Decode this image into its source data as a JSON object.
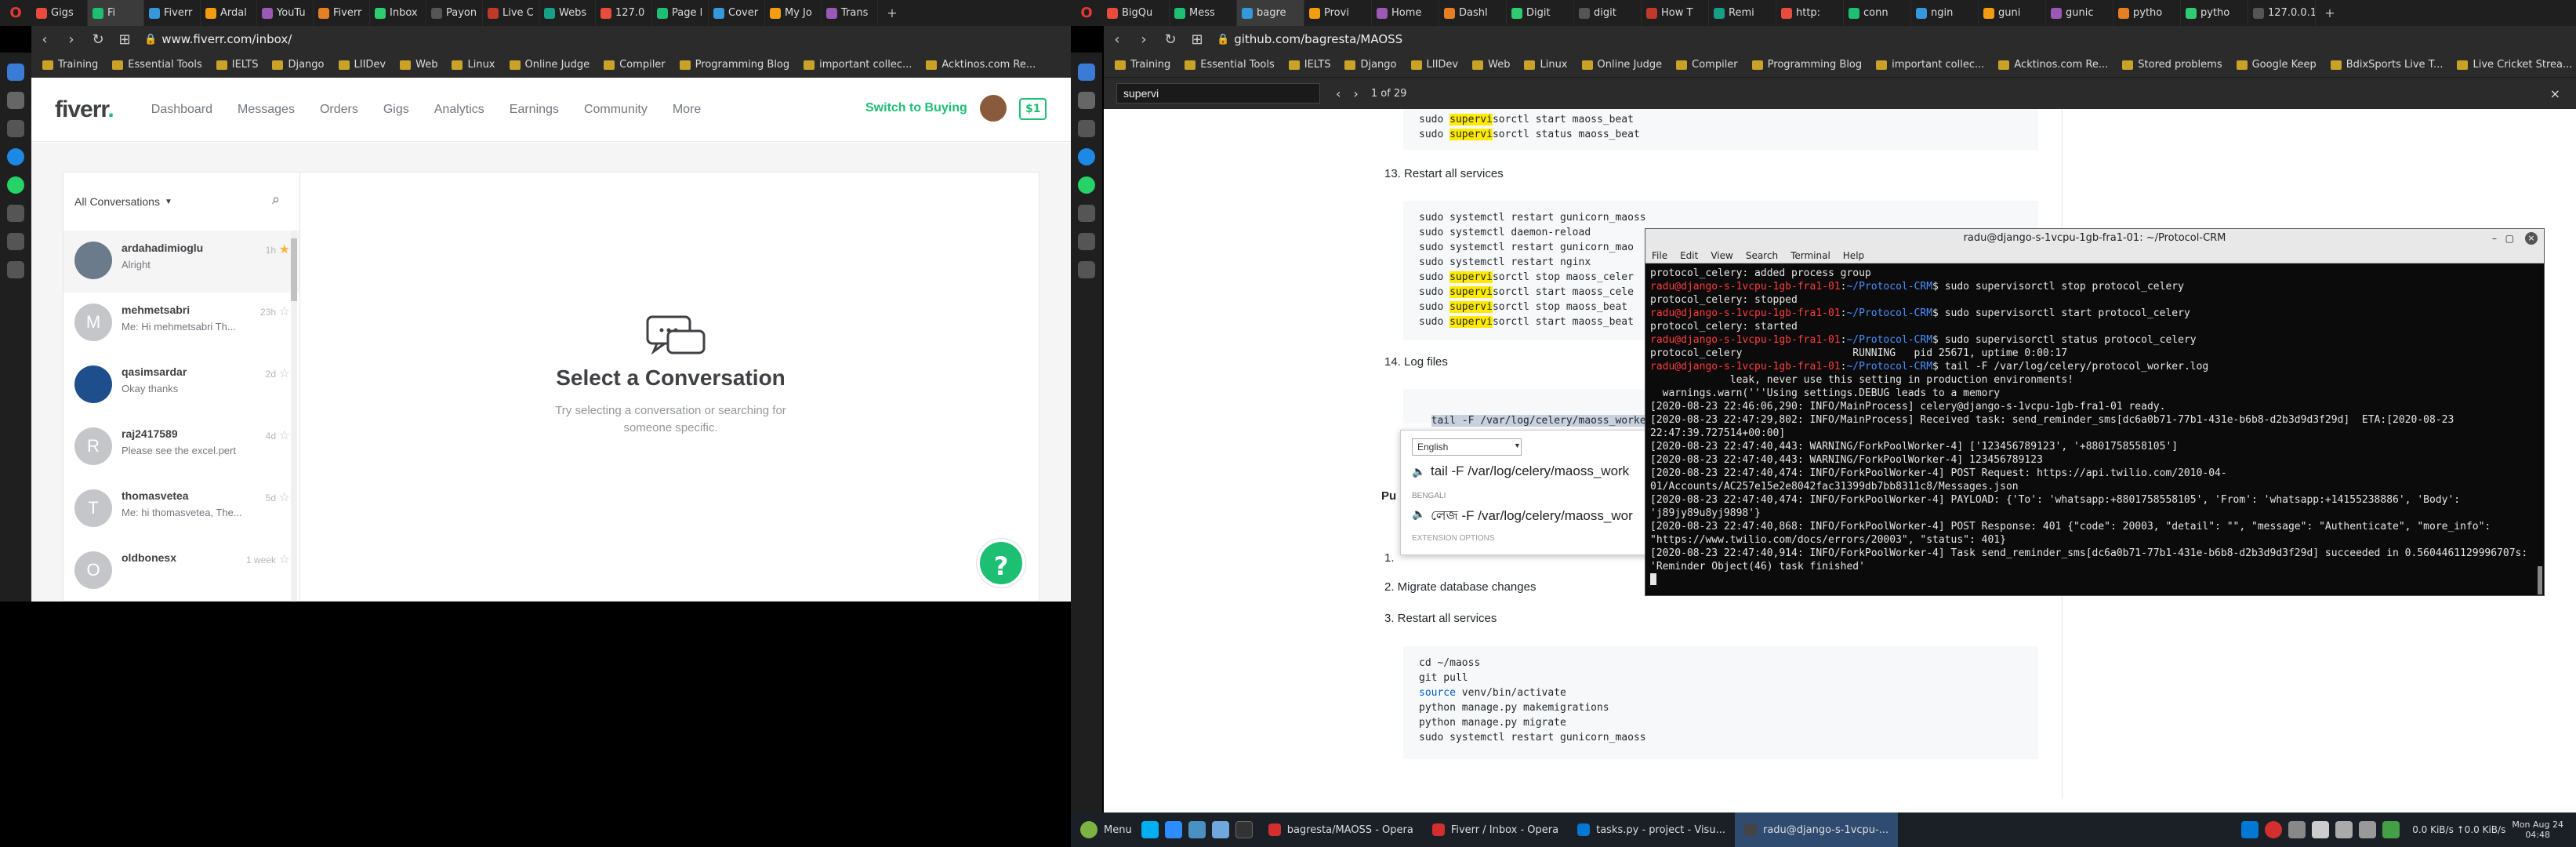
{
  "left_browser": {
    "tabs": [
      "Gigs",
      "Fi",
      "Fiverr",
      "Ardal",
      "YouTu",
      "Fiverr",
      "Inbox",
      "Payon",
      "Live C",
      "Webs",
      "127.0",
      "Page l",
      "Cover",
      "My Jo",
      "Trans"
    ],
    "url": "www.fiverr.com/inbox/",
    "bookmarks": [
      "Training",
      "Essential Tools",
      "IELTS",
      "Django",
      "LIIDev",
      "Web",
      "Linux",
      "Online Judge",
      "Compiler",
      "Programming Blog",
      "important collec...",
      "Acktinos.com Re..."
    ]
  },
  "fiverr": {
    "logo": "fiverr",
    "nav": [
      "Dashboard",
      "Messages",
      "Orders",
      "Gigs",
      "Analytics",
      "Earnings",
      "Community",
      "More"
    ],
    "switch_label": "Switch to Buying",
    "balance": "$1",
    "filter_label": "All Conversations",
    "conversations": [
      {
        "name": "ardahadimioglu",
        "msg": "Alright",
        "time": "1h",
        "initial": "",
        "color": "#6b7b8c",
        "starred": true
      },
      {
        "name": "mehmetsabri",
        "msg": "Me: Hi mehmetsabri Th...",
        "time": "23h",
        "initial": "M",
        "color": "#c5c6c9",
        "starred": false
      },
      {
        "name": "qasimsardar",
        "msg": "Okay thanks",
        "time": "2d",
        "initial": "",
        "color": "#1f4e8c",
        "starred": false
      },
      {
        "name": "raj2417589",
        "msg": "Please see the excel.pert",
        "time": "4d",
        "initial": "R",
        "color": "#c5c6c9",
        "starred": false
      },
      {
        "name": "thomasvetea",
        "msg": "Me: hi thomasvetea, The...",
        "time": "5d",
        "initial": "T",
        "color": "#c5c6c9",
        "starred": false
      },
      {
        "name": "oldbonesx",
        "msg": "",
        "time": "1 week",
        "initial": "O",
        "color": "#c5c6c9",
        "starred": false
      }
    ],
    "empty_title": "Select a Conversation",
    "empty_sub": "Try selecting a conversation or searching for someone specific.",
    "help": "?"
  },
  "right_browser": {
    "tabs": [
      "BigQu",
      "Mess",
      "bagre",
      "Provi",
      "Home",
      "Dashl",
      "Digit",
      "digit",
      "How T",
      "Remi",
      "http:",
      "conn",
      "ngin",
      "guni",
      "gunic",
      "pytho",
      "pytho",
      "127.0.0.1"
    ],
    "url": "github.com/bagresta/MAOSS",
    "bookmarks": [
      "Training",
      "Essential Tools",
      "IELTS",
      "Django",
      "LIIDev",
      "Web",
      "Linux",
      "Online Judge",
      "Compiler",
      "Programming Blog",
      "important collec...",
      "Acktinos.com Re...",
      "Stored problems",
      "Google Keep",
      "BdixSports Live T...",
      "Live Cricket Strea..."
    ],
    "find_query": "supervi",
    "find_count": "1 of 29"
  },
  "github": {
    "code_top": [
      "sudo supervisorctl start maoss_beat",
      "sudo supervisorctl status maoss_beat"
    ],
    "step13": "13. Restart all services",
    "code13": [
      "sudo systemctl restart gunicorn_maoss",
      "sudo systemctl daemon-reload",
      "sudo systemctl restart gunicorn_mao",
      "sudo systemctl restart nginx",
      "sudo supervisorctl stop maoss_celer",
      "sudo supervisorctl start maoss_cele",
      "sudo supervisorctl stop maoss_beat",
      "sudo supervisorctl start maoss_beat"
    ],
    "step14": "14. Log files",
    "log_line": "tail -F /var/log/celery/maoss_worke",
    "pu_prefix": "Pu",
    "step1": "1.",
    "step2": "2. Migrate database changes",
    "step3": "3. Restart all services",
    "code_bottom": [
      "cd ~/maoss",
      "git pull",
      "source venv/bin/activate",
      "python manage.py makemigrations",
      "python manage.py migrate",
      "sudo systemctl restart gunicorn_maoss"
    ]
  },
  "translate_popup": {
    "language": "English",
    "line1": "tail -F /var/log/celery/maoss_work",
    "section": "BENGALI",
    "line2": "লেজ -F /var/log/celery/maoss_wor",
    "options": "EXTENSION OPTIONS"
  },
  "terminal": {
    "title": "radu@django-s-1vcpu-1gb-fra1-01: ~/Protocol-CRM",
    "menu": [
      "File",
      "Edit",
      "View",
      "Search",
      "Terminal",
      "Help"
    ],
    "lines": [
      "protocol_celery: added process group",
      "radu@django-s-1vcpu-1gb-fra1-01:~/Protocol-CRM$ sudo supervisorctl stop protocol_celery",
      "protocol_celery: stopped",
      "radu@django-s-1vcpu-1gb-fra1-01:~/Protocol-CRM$ sudo supervisorctl start protocol_celery",
      "protocol_celery: started",
      "radu@django-s-1vcpu-1gb-fra1-01:~/Protocol-CRM$ sudo supervisorctl status protocol_celery",
      "protocol_celery                  RUNNING   pid 25671, uptime 0:00:17",
      "radu@django-s-1vcpu-1gb-fra1-01:~/Protocol-CRM$ tail -F /var/log/celery/protocol_worker.log",
      "             leak, never use this setting in production environments!",
      "  warnings.warn('''Using settings.DEBUG leads to a memory",
      "[2020-08-23 22:46:06,290: INFO/MainProcess] celery@django-s-1vcpu-1gb-fra1-01 ready.",
      "[2020-08-23 22:47:29,802: INFO/MainProcess] Received task: send_reminder_sms[dc6a0b71-77b1-431e-b6b8-d2b3d9d3f29d]  ETA:[2020-08-23 22:47:39.727514+00:00]",
      "[2020-08-23 22:47:40,443: WARNING/ForkPoolWorker-4] ['123456789123', '+8801758558105']",
      "[2020-08-23 22:47:40,443: WARNING/ForkPoolWorker-4] 123456789123",
      "[2020-08-23 22:47:40,474: INFO/ForkPoolWorker-4] POST Request: https://api.twilio.com/2010-04-01/Accounts/AC257e15e2e8042fac31399db7bb8311c8/Messages.json",
      "[2020-08-23 22:47:40,474: INFO/ForkPoolWorker-4] PAYLOAD: {'To': 'whatsapp:+8801758558105', 'From': 'whatsapp:+14155238886', 'Body': 'j89jy89u8yj9898'}",
      "[2020-08-23 22:47:40,868: INFO/ForkPoolWorker-4] POST Response: 401 {\"code\": 20003, \"detail\": \"\", \"message\": \"Authenticate\", \"more_info\": \"https://www.twilio.com/docs/errors/20003\", \"status\": 401}",
      "[2020-08-23 22:47:40,914: INFO/ForkPoolWorker-4] Task send_reminder_sms[dc6a0b71-77b1-431e-b6b8-d2b3d9d3f29d] succeeded in 0.5604461129996707s: 'Reminder Object(46) task finished'"
    ]
  },
  "taskbar": {
    "menu": "Menu",
    "items": [
      "bagresta/MAOSS - Opera",
      "Fiverr / Inbox - Opera",
      "tasks.py - project - Visu...",
      "radu@django-s-1vcpu-..."
    ],
    "net": "0.0 KiB/s ↑0.0 KiB/s",
    "date": "Mon Aug 24",
    "time": "04:48"
  }
}
